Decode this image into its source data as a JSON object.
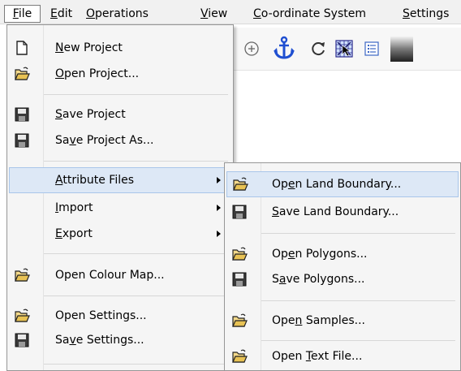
{
  "menubar": {
    "items": [
      {
        "label": "File",
        "key": "F",
        "rest": "ile"
      },
      {
        "label": "Edit",
        "key": "E",
        "rest": "dit"
      },
      {
        "label": "Operations",
        "key": "O",
        "rest": "perations"
      },
      {
        "label": "View",
        "key": "V",
        "rest": "iew"
      },
      {
        "label": "Co-ordinate System",
        "key": "C",
        "rest": "o-ordinate System"
      },
      {
        "label": "Settings",
        "key": "S",
        "rest": "ettings"
      }
    ]
  },
  "toolbar": {
    "icons": [
      "zoom-in-icon",
      "anchor-icon",
      "refresh-icon",
      "grid-select-icon",
      "list-icon",
      "gradient-icon"
    ]
  },
  "file_menu": {
    "items": [
      {
        "pre": "",
        "key": "N",
        "post": "ew Project",
        "icon": "new-document-icon"
      },
      {
        "pre": "",
        "key": "O",
        "post": "pen Project...",
        "icon": "open-folder-icon"
      },
      {
        "pre": "",
        "key": "S",
        "post": "ave Project",
        "icon": "save-disk-icon"
      },
      {
        "pre": "Sa",
        "key": "v",
        "post": "e Project As...",
        "icon": "save-disk-icon"
      },
      {
        "pre": "",
        "key": "A",
        "post": "ttribute Files",
        "submenu": true
      },
      {
        "pre": "",
        "key": "I",
        "post": "mport",
        "submenu": true
      },
      {
        "pre": "",
        "key": "E",
        "post": "xport",
        "submenu": true
      },
      {
        "pre": "Open Colour Map...",
        "key": "",
        "post": "",
        "icon": "open-folder-icon"
      },
      {
        "pre": "Open Settings...",
        "key": "",
        "post": "",
        "icon": "open-folder-icon"
      },
      {
        "pre": "Sa",
        "key": "v",
        "post": "e Settings...",
        "icon": "save-disk-icon"
      }
    ]
  },
  "attribute_submenu": {
    "items": [
      {
        "pre": "Op",
        "key": "e",
        "post": "n Land Boundary...",
        "icon": "open-folder-icon"
      },
      {
        "pre": "",
        "key": "S",
        "post": "ave Land Boundary...",
        "icon": "save-disk-icon"
      },
      {
        "pre": "Op",
        "key": "e",
        "post": "n Polygons...",
        "icon": "open-folder-icon"
      },
      {
        "pre": "S",
        "key": "a",
        "post": "ve Polygons...",
        "icon": "save-disk-icon"
      },
      {
        "pre": "Ope",
        "key": "n",
        "post": " Samples...",
        "icon": "open-folder-icon"
      },
      {
        "pre": "Open ",
        "key": "T",
        "post": "ext File...",
        "icon": "open-folder-icon"
      }
    ]
  },
  "colors": {
    "highlight": "#dde8f6",
    "highlight_border": "#a9c6ea",
    "folder": "#e8c254",
    "disk": "#3a3a3a",
    "anchor": "#1f4fd1"
  }
}
